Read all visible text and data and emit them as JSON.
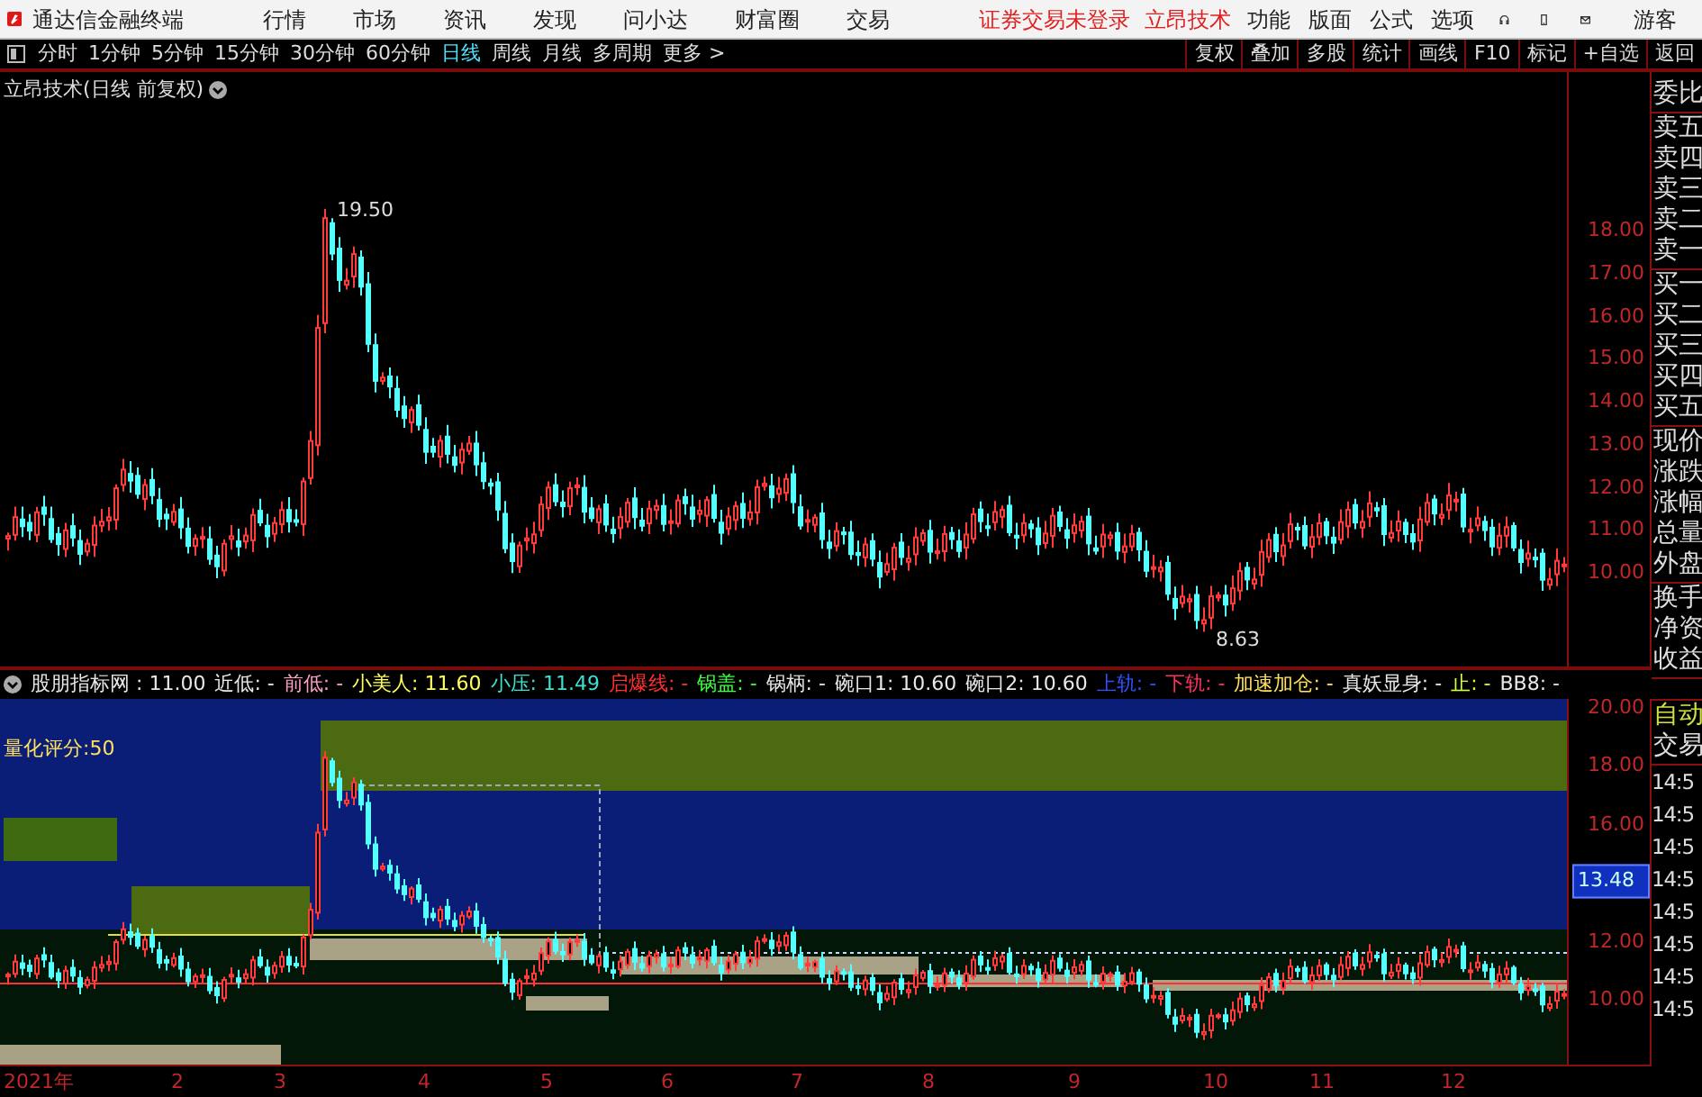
{
  "menu_bar": {
    "app_title": "通达信金融终端",
    "menus": [
      "行情",
      "市场",
      "资讯",
      "发现",
      "问小达",
      "财富圈",
      "交易"
    ],
    "notices": [
      "证券交易未登录",
      "立昂技术"
    ],
    "right_menus": [
      "功能",
      "版面",
      "公式",
      "选项"
    ],
    "user": "游客"
  },
  "period_bar": {
    "periods": [
      {
        "label": "分时",
        "selected": false
      },
      {
        "label": "1分钟",
        "selected": false
      },
      {
        "label": "5分钟",
        "selected": false
      },
      {
        "label": "15分钟",
        "selected": false
      },
      {
        "label": "30分钟",
        "selected": false
      },
      {
        "label": "60分钟",
        "selected": false
      },
      {
        "label": "日线",
        "selected": true
      },
      {
        "label": "周线",
        "selected": false
      },
      {
        "label": "月线",
        "selected": false
      },
      {
        "label": "多周期",
        "selected": false
      },
      {
        "label": "更多 >",
        "selected": false
      }
    ],
    "tools": [
      "复权",
      "叠加",
      "多股",
      "统计",
      "画线",
      "F10",
      "标记",
      "+自选",
      "返回"
    ]
  },
  "main_chart": {
    "title": "立昂技术(日线 前复权)",
    "high_label": "19.50",
    "low_label": "8.63",
    "yticks": [
      "18.00",
      "17.00",
      "16.00",
      "15.00",
      "14.00",
      "13.00",
      "12.00",
      "11.00",
      "10.00"
    ]
  },
  "indicator": {
    "readouts": [
      {
        "text": "股朋指标网 : 11.00",
        "color": "#e8e8e8"
      },
      {
        "text": "近低: -",
        "color": "#e8e8e8"
      },
      {
        "text": "前低: -",
        "color": "#ff9fc8"
      },
      {
        "text": "小美人: 11.60",
        "color": "#ffff60"
      },
      {
        "text": "小压: 11.49",
        "color": "#40e0d0"
      },
      {
        "text": "启爆线: -",
        "color": "#ff3030"
      },
      {
        "text": "锅盖: -",
        "color": "#40ff40"
      },
      {
        "text": "锅柄: -",
        "color": "#e8e8e8"
      },
      {
        "text": "碗口1: 10.60",
        "color": "#e8e8e8"
      },
      {
        "text": "碗口2: 10.60",
        "color": "#e8e8e8"
      },
      {
        "text": "上轨: -",
        "color": "#3050ff"
      },
      {
        "text": "下轨: -",
        "color": "#ff3060"
      },
      {
        "text": "加速加仓: -",
        "color": "#ffe060"
      },
      {
        "text": "真妖显身: -",
        "color": "#e8e8e8"
      },
      {
        "text": "止: -",
        "color": "#d0ff40"
      },
      {
        "text": "BB8: -",
        "color": "#e8e8e8"
      }
    ],
    "score_label": "量化评分:50",
    "yticks": [
      "20.00",
      "18.00",
      "16.00",
      "12.00",
      "10.00"
    ],
    "current_value": "13.48"
  },
  "date_axis": [
    "2021年",
    "2",
    "3",
    "4",
    "5",
    "6",
    "7",
    "8",
    "9",
    "10",
    "11",
    "12"
  ],
  "side_panel": {
    "quote_groups": [
      [
        "委比"
      ],
      [
        "卖五",
        "卖四",
        "卖三",
        "卖二",
        "卖一"
      ],
      [
        "买一",
        "买二",
        "买三",
        "买四",
        "买五"
      ],
      [
        "现价",
        "涨跌",
        "涨幅",
        "总量",
        "外盘"
      ],
      [
        "换手",
        "净资",
        "收益"
      ]
    ],
    "trade_header": "自动",
    "trade_title": "交易",
    "times": [
      "14:5",
      "14:5",
      "14:5",
      "14:5",
      "14:5",
      "14:5",
      "14:5",
      "14:5"
    ]
  }
}
